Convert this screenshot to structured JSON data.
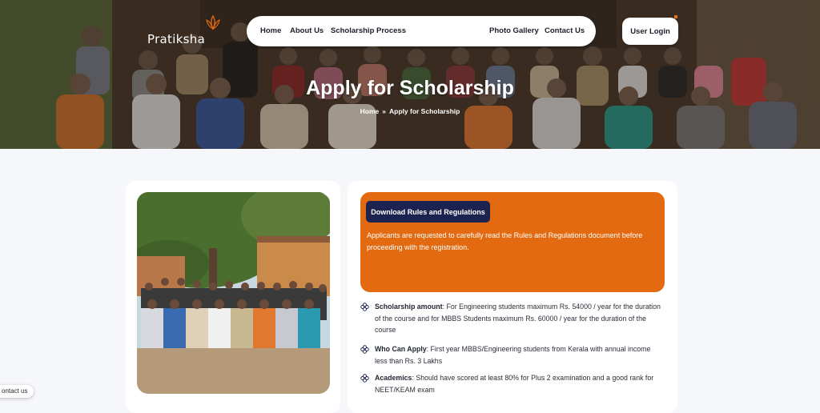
{
  "brand": {
    "name": "Pratiksha"
  },
  "nav": {
    "items": [
      "Home",
      "About Us",
      "Scholarship Process",
      "Photo Gallery",
      "Contact Us"
    ],
    "login": "User Login"
  },
  "hero": {
    "title": "Apply for Scholarship",
    "breadcrumb": {
      "home": "Home",
      "separator": "»",
      "current": "Apply for Scholarship"
    }
  },
  "apply_box": {
    "download_label": "Download Rules and Regulations",
    "notice": "Applicants are requested to carefully read the Rules and Regulations document before proceeding with the registration."
  },
  "features": [
    {
      "title": "Scholarship amount",
      "text": ": For Engineering students maximum Rs. 54000 / year for the duration of the course and for MBBS Students maximum Rs. 60000 / year for the duration of the course"
    },
    {
      "title": "Who Can Apply",
      "text": ": First year MBBS/Engineering students from Kerala with annual income less than Rs. 3 Lakhs"
    },
    {
      "title": "Academics",
      "text": ": Should have scored at least 80% for Plus 2 examination and a good rank for NEET/KEAM exam"
    }
  ],
  "contact_widget": {
    "label": "ontact us"
  },
  "colors": {
    "accent": "#e36a10",
    "button_dark": "#1d2350",
    "page_bg": "#f6f7fb"
  }
}
